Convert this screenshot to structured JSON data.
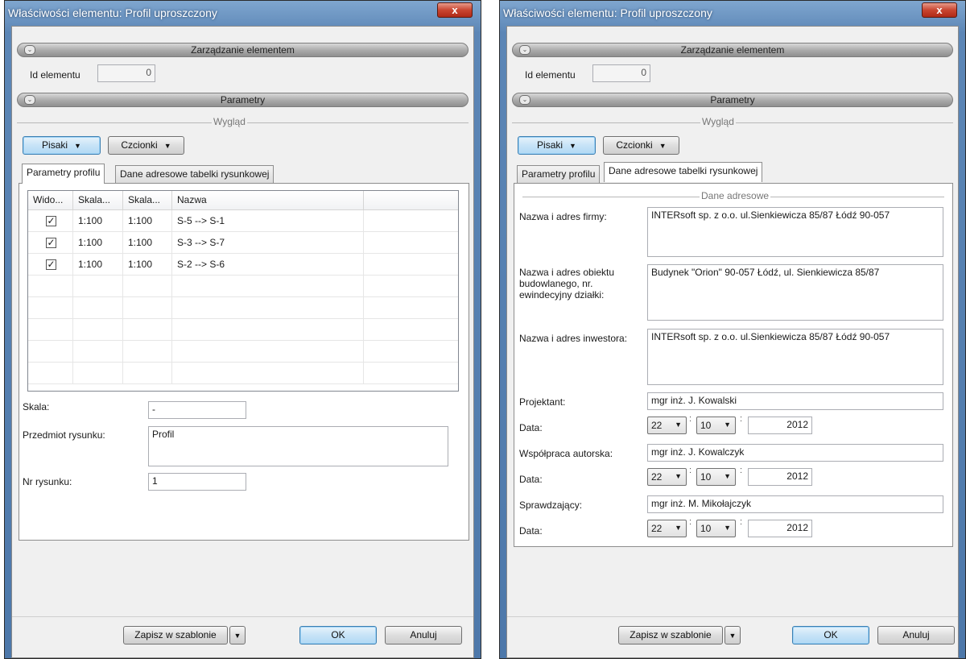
{
  "left_window": {
    "title": "Właściwości elementu: Profil uproszczony",
    "close_label": "x",
    "section_manage": "Zarządzanie elementem",
    "id_label": "Id elementu",
    "id_value": "0",
    "section_params": "Parametry",
    "group_look": "Wygląd",
    "pens_button": "Pisaki",
    "fonts_button": "Czcionki",
    "tabs": [
      "Parametry profilu",
      "Dane adresowe tabelki rysunkowej"
    ],
    "columns": [
      "Wido...",
      "Skala...",
      "Skala...",
      "Nazwa"
    ],
    "rows": [
      {
        "visible": true,
        "scale1": "1:100",
        "scale2": "1:100",
        "name": "S-5 --> S-1"
      },
      {
        "visible": true,
        "scale1": "1:100",
        "scale2": "1:100",
        "name": "S-3 --> S-7"
      },
      {
        "visible": true,
        "scale1": "1:100",
        "scale2": "1:100",
        "name": "S-2 --> S-6"
      }
    ],
    "scale_label": "Skala:",
    "scale_value": "-",
    "subject_label": "Przedmiot rysunku:",
    "subject_value": "Profil",
    "number_label": "Nr rysunku:",
    "number_value": "1",
    "save_template": "Zapisz w szablonie",
    "ok": "OK",
    "cancel": "Anuluj"
  },
  "right_window": {
    "title": "Właściwości elementu: Profil uproszczony",
    "close_label": "x",
    "section_manage": "Zarządzanie elementem",
    "id_label": "Id elementu",
    "id_value": "0",
    "section_params": "Parametry",
    "group_look": "Wygląd",
    "pens_button": "Pisaki",
    "fonts_button": "Czcionki",
    "tabs": [
      "Parametry profilu",
      "Dane adresowe tabelki rysunkowej"
    ],
    "group_address": "Dane adresowe",
    "company_label": "Nazwa i adres firmy:",
    "company_value": "INTERsoft sp. z o.o. ul.Sienkiewicza 85/87 Łódź 90-057",
    "object_label": "Nazwa i adres obiektu budowlanego, nr. ewindecyjny działki:",
    "object_value": "Budynek \"Orion\" 90-057 Łódź, ul. Sienkiewicza 85/87",
    "investor_label": "Nazwa i adres inwestora:",
    "investor_value": "INTERsoft sp. z o.o. ul.Sienkiewicza 85/87 Łódź 90-057",
    "designer_label": "Projektant:",
    "designer_value": "mgr inż. J. Kowalski",
    "date_label": "Data:",
    "coauthor_label": "Współpraca autorska:",
    "coauthor_value": "mgr inż. J. Kowalczyk",
    "checker_label": "Sprawdzający:",
    "checker_value": "mgr inż. M. Mikołajczyk",
    "date_day": "22",
    "date_month": "10",
    "date_year": "2012",
    "date_sep": ":",
    "save_template": "Zapisz w szablonie",
    "ok": "OK",
    "cancel": "Anuluj"
  }
}
